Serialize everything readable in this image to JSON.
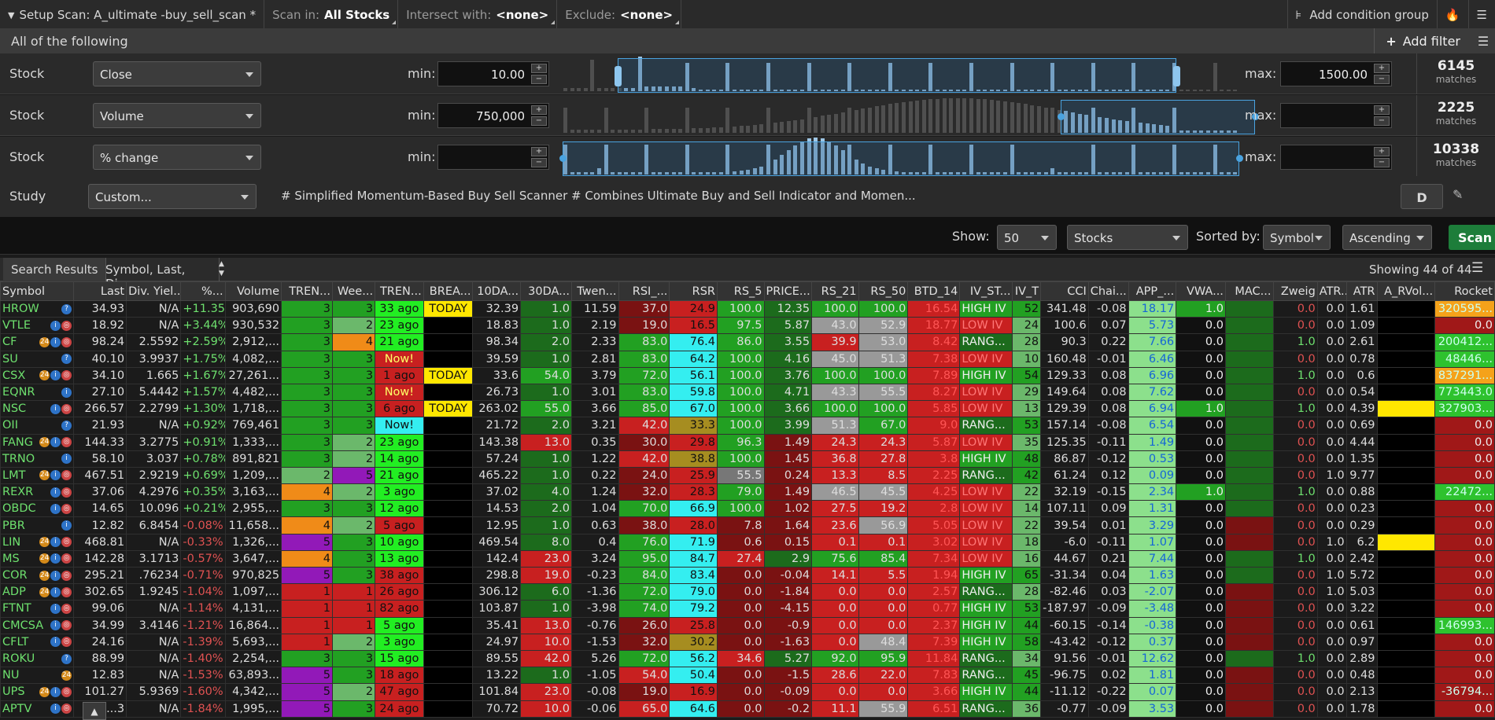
{
  "topbar": {
    "setup": "Setup Scan: A_ultimate -buy_sell_scan *",
    "scan_in_label": "Scan in:",
    "scan_in_value": "All Stocks",
    "intersect_label": "Intersect with:",
    "intersect_value": "<none>",
    "exclude_label": "Exclude:",
    "exclude_value": "<none>",
    "add_group": "Add condition group"
  },
  "criteria": {
    "all_label": "All of the following",
    "add_filter": "Add filter"
  },
  "filters": [
    {
      "type": "Stock",
      "field": "Close",
      "min_label": "min:",
      "min": "10.00",
      "max_label": "max:",
      "max": "1500.00",
      "matches": "6145",
      "matches_label": "matches"
    },
    {
      "type": "Stock",
      "field": "Volume",
      "min_label": "min:",
      "min": "750,000",
      "max_label": "max:",
      "max": "",
      "matches": "2225",
      "matches_label": "matches"
    },
    {
      "type": "Stock",
      "field": "% change",
      "min_label": "min:",
      "min": "",
      "max_label": "max:",
      "max": "",
      "matches": "10338",
      "matches_label": "matches"
    }
  ],
  "study": {
    "type": "Study",
    "field": "Custom...",
    "text": "# Simplified Momentum-Based Buy Sell Scanner # Combines Ultimate Buy and Sell Indicator and Momen...",
    "agg": "D"
  },
  "show": {
    "label": "Show:",
    "count": "50",
    "list": "Stocks",
    "sorted_label": "Sorted by:",
    "sort_field": "Symbol",
    "order": "Ascending",
    "scan_btn": "Scan"
  },
  "results": {
    "tab": "Search Results",
    "tab2": "Symbol, Last, Di...",
    "showing": "Showing 44 of 44"
  },
  "columns": [
    "Symbol",
    "Last",
    "Div. Yiel...",
    "%...",
    "Volume",
    "TREN...",
    "Wee...",
    "TREN...",
    "BREA...",
    "10DA...",
    "30DA...",
    "Twen...",
    "RSI_...",
    "RSR",
    "RS_5",
    "PRICE...",
    "RS_21",
    "RS_50",
    "BTD_14",
    "IV_ST...",
    "IV_T",
    "CCI",
    "Chai...",
    "APP_...",
    "VWA...",
    "MAC...",
    "Zweig",
    "ATR...",
    "ATR",
    "A_RVol...",
    "Rocket"
  ],
  "rows": [
    [
      "HROW",
      "34.93",
      "N/A",
      "+11.35%",
      "903,690",
      "3",
      "3",
      "33 ago",
      "TODAY",
      "32.39",
      "1.0",
      "11.59",
      "37.0",
      "24.9",
      "100.0",
      "12.35",
      "100.0",
      "100.0",
      "16.54",
      "HIGH IV",
      "52",
      "341.48",
      "-0.08",
      "18.17",
      "1.0",
      "",
      "0.0",
      "0.0",
      "1.61",
      "",
      "320595..."
    ],
    [
      "VTLE",
      "18.92",
      "N/A",
      "+3.44%",
      "930,532",
      "3",
      "2",
      "23 ago",
      "",
      "18.83",
      "1.0",
      "2.19",
      "19.0",
      "16.5",
      "97.5",
      "5.87",
      "43.0",
      "52.9",
      "18.77",
      "LOW IV",
      "24",
      "100.6",
      "0.07",
      "5.73",
      "0.0",
      "",
      "0.0",
      "0.0",
      "1.09",
      "",
      "0.0"
    ],
    [
      "CF",
      "98.24",
      "2.5592",
      "+2.59%",
      "2,912,...",
      "3",
      "4",
      "21 ago",
      "",
      "98.34",
      "2.0",
      "2.33",
      "83.0",
      "76.4",
      "86.0",
      "3.55",
      "39.9",
      "53.0",
      "8.42",
      "RANG...",
      "28",
      "90.3",
      "0.22",
      "7.66",
      "0.0",
      "",
      "1.0",
      "0.0",
      "2.61",
      "",
      "200412..."
    ],
    [
      "SU",
      "40.10",
      "3.9937",
      "+1.75%",
      "4,082,...",
      "3",
      "3",
      "Now!",
      "",
      "39.59",
      "1.0",
      "2.81",
      "83.0",
      "64.2",
      "100.0",
      "4.16",
      "45.0",
      "51.3",
      "7.38",
      "LOW IV",
      "10",
      "160.48",
      "-0.01",
      "6.46",
      "0.0",
      "",
      "0.0",
      "0.0",
      "0.78",
      "",
      "48446..."
    ],
    [
      "CSX",
      "34.10",
      "1.665",
      "+1.67%",
      "27,261...",
      "3",
      "3",
      "1 ago",
      "TODAY",
      "33.6",
      "54.0",
      "3.79",
      "72.0",
      "56.1",
      "100.0",
      "3.76",
      "100.0",
      "100.0",
      "7.89",
      "HIGH IV",
      "54",
      "129.33",
      "0.08",
      "6.96",
      "0.0",
      "",
      "1.0",
      "0.0",
      "0.6",
      "",
      "837291..."
    ],
    [
      "EQNR",
      "27.10",
      "5.4442",
      "+1.57%",
      "4,482,...",
      "3",
      "3",
      "Now!",
      "",
      "26.73",
      "1.0",
      "3.01",
      "83.0",
      "59.8",
      "100.0",
      "4.71",
      "43.3",
      "55.5",
      "8.27",
      "LOW IV",
      "29",
      "149.64",
      "0.08",
      "7.62",
      "0.0",
      "",
      "0.0",
      "0.0",
      "0.54",
      "",
      "773443.0"
    ],
    [
      "NSC",
      "266.57",
      "2.2799",
      "+1.30%",
      "1,718,...",
      "3",
      "3",
      "6 ago",
      "TODAY",
      "263.02",
      "55.0",
      "3.66",
      "85.0",
      "67.0",
      "100.0",
      "3.66",
      "100.0",
      "100.0",
      "5.85",
      "LOW IV",
      "13",
      "129.39",
      "0.08",
      "6.94",
      "1.0",
      "",
      "1.0",
      "0.0",
      "4.39",
      "",
      "327903..."
    ],
    [
      "OII",
      "21.93",
      "N/A",
      "+0.92%",
      "769,461",
      "3",
      "3",
      "Now!",
      "",
      "21.72",
      "2.0",
      "3.21",
      "42.0",
      "33.3",
      "100.0",
      "3.99",
      "51.3",
      "67.0",
      "9.0",
      "RANG...",
      "53",
      "157.14",
      "-0.08",
      "6.54",
      "0.0",
      "",
      "0.0",
      "0.0",
      "0.69",
      "",
      "0.0"
    ],
    [
      "FANG",
      "144.33",
      "3.2775",
      "+0.91%",
      "1,333,...",
      "3",
      "2",
      "23 ago",
      "",
      "143.38",
      "13.0",
      "0.35",
      "30.0",
      "29.8",
      "96.3",
      "1.49",
      "24.3",
      "24.3",
      "5.87",
      "LOW IV",
      "35",
      "125.35",
      "-0.11",
      "1.49",
      "0.0",
      "",
      "0.0",
      "0.0",
      "4.44",
      "",
      "0.0"
    ],
    [
      "TRNO",
      "58.10",
      "3.037",
      "+0.78%",
      "891,821",
      "3",
      "2",
      "14 ago",
      "",
      "57.24",
      "1.0",
      "1.22",
      "42.0",
      "38.8",
      "100.0",
      "1.45",
      "36.8",
      "27.8",
      "3.8",
      "HIGH IV",
      "48",
      "86.87",
      "-0.12",
      "0.53",
      "0.0",
      "",
      "0.0",
      "0.0",
      "1.35",
      "",
      "0.0"
    ],
    [
      "LMT",
      "467.51",
      "2.9219",
      "+0.69%",
      "1,209,...",
      "2",
      "5",
      "21 ago",
      "",
      "465.22",
      "1.0",
      "0.22",
      "24.0",
      "25.9",
      "55.5",
      "0.24",
      "13.3",
      "8.5",
      "2.25",
      "RANG...",
      "42",
      "61.24",
      "0.12",
      "0.09",
      "0.0",
      "",
      "0.0",
      "1.0",
      "9.77",
      "",
      "0.0"
    ],
    [
      "REXR",
      "37.06",
      "4.2976",
      "+0.35%",
      "3,163,...",
      "4",
      "2",
      "3 ago",
      "",
      "37.02",
      "4.0",
      "1.24",
      "32.0",
      "28.3",
      "79.0",
      "1.49",
      "46.5",
      "45.5",
      "4.25",
      "LOW IV",
      "22",
      "32.19",
      "-0.15",
      "2.34",
      "1.0",
      "",
      "1.0",
      "0.0",
      "0.88",
      "",
      "22472..."
    ],
    [
      "OBDC",
      "14.65",
      "10.096",
      "+0.21%",
      "2,955,...",
      "3",
      "3",
      "12 ago",
      "",
      "14.53",
      "2.0",
      "1.04",
      "70.0",
      "66.9",
      "100.0",
      "1.02",
      "27.5",
      "19.2",
      "2.8",
      "LOW IV",
      "14",
      "107.11",
      "0.09",
      "1.31",
      "0.0",
      "",
      "0.0",
      "0.0",
      "0.23",
      "",
      "0.0"
    ],
    [
      "PBR",
      "12.82",
      "6.8454",
      "-0.08%",
      "11,658...",
      "4",
      "2",
      "5 ago",
      "",
      "12.95",
      "1.0",
      "0.63",
      "38.0",
      "28.0",
      "7.8",
      "1.64",
      "23.6",
      "56.9",
      "5.05",
      "LOW IV",
      "22",
      "39.54",
      "0.01",
      "3.29",
      "0.0",
      "",
      "0.0",
      "0.0",
      "0.29",
      "",
      "0.0"
    ],
    [
      "LIN",
      "468.81",
      "N/A",
      "-0.33%",
      "1,326,...",
      "5",
      "3",
      "10 ago",
      "",
      "469.54",
      "8.0",
      "0.4",
      "76.0",
      "71.9",
      "0.6",
      "0.15",
      "0.1",
      "0.1",
      "3.02",
      "LOW IV",
      "18",
      "-6.0",
      "-0.11",
      "1.07",
      "0.0",
      "",
      "0.0",
      "1.0",
      "6.2",
      "",
      "0.0"
    ],
    [
      "MS",
      "142.28",
      "3.1713",
      "-0.57%",
      "3,647,...",
      "4",
      "3",
      "13 ago",
      "",
      "142.4",
      "23.0",
      "3.24",
      "95.0",
      "84.7",
      "27.4",
      "2.9",
      "75.6",
      "85.4",
      "7.34",
      "LOW IV",
      "16",
      "44.67",
      "0.21",
      "7.44",
      "0.0",
      "",
      "1.0",
      "0.0",
      "2.42",
      "",
      "0.0"
    ],
    [
      "COR",
      "295.21",
      ".76234",
      "-0.71%",
      "970,825",
      "5",
      "3",
      "38 ago",
      "",
      "298.8",
      "19.0",
      "-0.23",
      "84.0",
      "83.4",
      "0.0",
      "-0.04",
      "14.1",
      "5.5",
      "1.94",
      "HIGH IV",
      "65",
      "-31.34",
      "0.04",
      "1.63",
      "0.0",
      "",
      "0.0",
      "1.0",
      "5.72",
      "",
      "0.0"
    ],
    [
      "ADP",
      "302.65",
      "1.9245",
      "-1.04%",
      "1,097,...",
      "1",
      "1",
      "26 ago",
      "",
      "306.12",
      "6.0",
      "-1.36",
      "72.0",
      "79.0",
      "0.0",
      "-1.84",
      "0.0",
      "0.0",
      "2.57",
      "RANG...",
      "28",
      "-82.46",
      "0.03",
      "-2.07",
      "0.0",
      "",
      "0.0",
      "1.0",
      "5.03",
      "",
      "0.0"
    ],
    [
      "FTNT",
      "99.06",
      "N/A",
      "-1.14%",
      "4,131,...",
      "1",
      "1",
      "82 ago",
      "",
      "103.87",
      "1.0",
      "-3.98",
      "74.0",
      "79.2",
      "0.0",
      "-4.15",
      "0.0",
      "0.0",
      "0.77",
      "HIGH IV",
      "53",
      "-187.97",
      "-0.09",
      "-3.48",
      "0.0",
      "",
      "0.0",
      "0.0",
      "3.22",
      "",
      "0.0"
    ],
    [
      "CMCSA",
      "34.99",
      "3.4146",
      "-1.21%",
      "16,864...",
      "1",
      "1",
      "5 ago",
      "",
      "35.41",
      "13.0",
      "-0.76",
      "26.0",
      "25.8",
      "0.0",
      "-0.9",
      "0.0",
      "0.0",
      "2.37",
      "HIGH IV",
      "44",
      "-60.15",
      "-0.14",
      "-0.38",
      "0.0",
      "",
      "0.0",
      "0.0",
      "0.61",
      "",
      "146993..."
    ],
    [
      "CFLT",
      "24.16",
      "N/A",
      "-1.39%",
      "5,693,...",
      "1",
      "2",
      "3 ago",
      "",
      "24.97",
      "10.0",
      "-1.53",
      "32.0",
      "30.2",
      "0.0",
      "-1.63",
      "0.0",
      "48.4",
      "7.39",
      "HIGH IV",
      "58",
      "-43.42",
      "-0.12",
      "0.37",
      "0.0",
      "",
      "0.0",
      "0.0",
      "0.97",
      "",
      "0.0"
    ],
    [
      "ROKU",
      "88.99",
      "N/A",
      "-1.40%",
      "2,254,...",
      "3",
      "3",
      "15 ago",
      "",
      "89.55",
      "42.0",
      "5.26",
      "72.0",
      "56.2",
      "34.6",
      "5.27",
      "92.0",
      "95.9",
      "11.84",
      "RANG...",
      "34",
      "91.56",
      "-0.01",
      "12.62",
      "0.0",
      "",
      "1.0",
      "0.0",
      "2.89",
      "",
      "0.0"
    ],
    [
      "NU",
      "12.83",
      "N/A",
      "-1.53%",
      "63,893...",
      "5",
      "3",
      "18 ago",
      "",
      "13.22",
      "1.0",
      "-1.05",
      "54.0",
      "50.4",
      "0.0",
      "-1.5",
      "28.6",
      "22.0",
      "7.83",
      "RANG...",
      "45",
      "-96.75",
      "0.02",
      "1.81",
      "0.0",
      "",
      "0.0",
      "0.0",
      "0.48",
      "",
      "0.0"
    ],
    [
      "UPS",
      "101.27",
      "5.9369",
      "-1.60%",
      "4,342,...",
      "5",
      "2",
      "47 ago",
      "",
      "101.84",
      "23.0",
      "-0.08",
      "19.0",
      "16.9",
      "0.0",
      "-0.09",
      "0.0",
      "0.0",
      "3.66",
      "HIGH IV",
      "44",
      "-11.12",
      "-0.22",
      "0.07",
      "0.0",
      "",
      "0.0",
      "0.0",
      "2.13",
      "",
      "-36794..."
    ],
    [
      "APTV",
      "...3",
      "N/A",
      "-1.84%",
      "1,995,...",
      "5",
      "3",
      "24 ago",
      "",
      "70.72",
      "10.0",
      "-0.06",
      "65.0",
      "64.6",
      "0.0",
      "-0.2",
      "11.1",
      "55.9",
      "6.51",
      "RANG...",
      "36",
      "-0.77",
      "-0.09",
      "3.53",
      "0.0",
      "",
      "0.0",
      "0.0",
      "1.78",
      "",
      "0.0"
    ]
  ]
}
